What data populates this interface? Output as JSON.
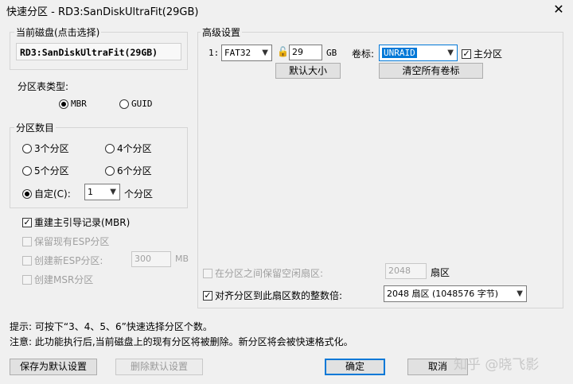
{
  "window": {
    "title": "快速分区 - RD3:SanDiskUltraFit(29GB)",
    "close_glyph": "✕"
  },
  "disk_group": {
    "legend": "当前磁盘(点击选择)",
    "disk_name": "RD3:SanDiskUltraFit(29GB)"
  },
  "table_type": {
    "label": "分区表类型:",
    "mbr": "MBR",
    "guid": "GUID",
    "selected": "MBR"
  },
  "partition_count": {
    "legend": "分区数目",
    "options": [
      "3个分区",
      "4个分区",
      "5个分区",
      "6个分区"
    ],
    "custom_label": "自定(C):",
    "custom_value": "1",
    "custom_suffix": "个分区"
  },
  "options": {
    "rebuild_mbr": "重建主引导记录(MBR)",
    "keep_esp": "保留现有ESP分区",
    "create_esp": "创建新ESP分区:",
    "esp_size": "300",
    "esp_unit": "MB",
    "create_msr": "创建MSR分区"
  },
  "advanced": {
    "legend": "高级设置",
    "row_index": "1:",
    "filesystem": "FAT32",
    "size": "29",
    "size_unit": "GB",
    "volume_label_caption": "卷标:",
    "volume_label": "UNRAID",
    "primary_label": "主分区",
    "default_size_button": "默认大小",
    "clear_labels_button": "清空所有卷标"
  },
  "sector": {
    "reserve_label": "在分区之间保留空闲扇区:",
    "reserve_value": "2048",
    "reserve_unit": "扇区",
    "align_label": "对齐分区到此扇区数的整数倍:",
    "align_value": "2048 扇区 (1048576 字节)"
  },
  "hints": {
    "tip": "提示: 可按下“3、4、5、6”快速选择分区个数。",
    "note": "注意: 此功能执行后,当前磁盘上的现有分区将被删除。新分区将会被快速格式化。"
  },
  "buttons": {
    "save_default": "保存为默认设置",
    "delete_default": "删除默认设置",
    "ok": "确定",
    "cancel": "取消"
  },
  "watermark": "知乎 @晓飞影"
}
